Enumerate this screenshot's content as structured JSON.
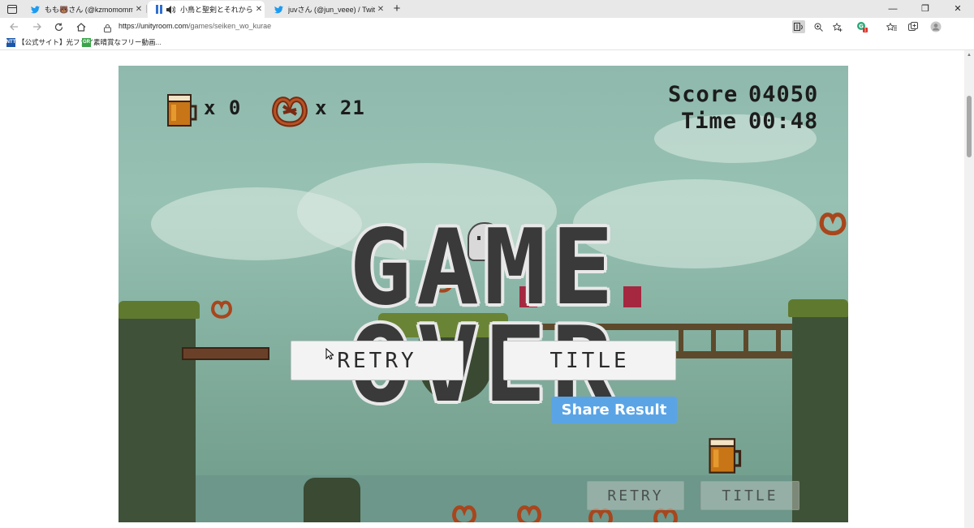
{
  "browser": {
    "tabs": [
      {
        "label": "もも🐻さん (@kzmomommd) / Tw",
        "icon": "twitter-icon",
        "active": false
      },
      {
        "label": "小鳥と聖剣とそれから毒煙 | フ",
        "icon": "unityroom-icon",
        "active": true
      },
      {
        "label": "juvさん (@jun_veee) / Twitter",
        "icon": "twitter-icon",
        "active": false
      }
    ],
    "new_tab_label": "+",
    "window_controls": {
      "minimize": "—",
      "maximize": "❐",
      "close": "✕"
    },
    "url_host": "https://unityroom.com",
    "url_path": "/games/seiken_wo_kurae",
    "bookmarks": [
      {
        "label": "【公式サイト】光ファイ...",
        "icon": "fiber-bookmark-icon",
        "icon_text": "NTT",
        "color": "#1c56a8"
      },
      {
        "label": "素晴賞なフリー動画...",
        "icon": "video-bookmark-icon",
        "icon_text": "GR",
        "color": "#3aa34a"
      }
    ],
    "profile_badge": "1"
  },
  "game": {
    "hud": {
      "beer_count": "x 0",
      "pretzel_count": "x 21",
      "score_label": "Score",
      "score_value": "04050",
      "time_label": "Time",
      "time_value": "00:48"
    },
    "title": "GAME OVER",
    "retry_label": "RETRY",
    "title_label": "TITLE",
    "share_label": "Share Result",
    "ghost_retry_label": "RETRY",
    "ghost_title_label": "TITLE"
  },
  "colors": {
    "accent": "#5aa4e6",
    "sky": "#8fb9ad",
    "twitter": "#1d9bf0"
  }
}
